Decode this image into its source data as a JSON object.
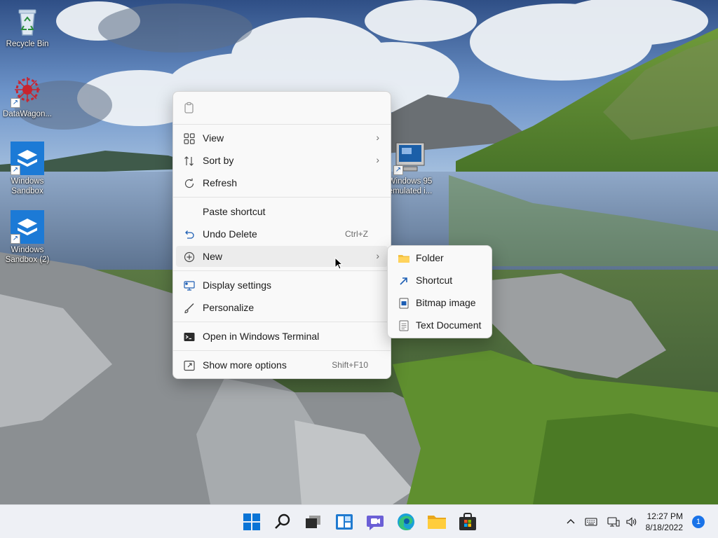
{
  "desktop": {
    "icons": [
      {
        "label": "Recycle Bin",
        "icon": "recycle-bin-icon",
        "shortcut": false
      },
      {
        "label": "DataWagon...",
        "icon": "datawagon-icon",
        "shortcut": true
      },
      {
        "label": "Windows Sandbox",
        "icon": "windows-sandbox-icon",
        "shortcut": true
      },
      {
        "label": "Windows Sandbox (2)",
        "icon": "windows-sandbox-icon",
        "shortcut": true
      },
      {
        "label": "Windows 95 emulated i...",
        "icon": "computer-monitor-icon",
        "shortcut": true
      }
    ]
  },
  "context_menu": {
    "toolbar": [
      {
        "icon": "copy-icon"
      }
    ],
    "items": [
      {
        "label": "View",
        "icon": "view-grid-icon",
        "submenu": true
      },
      {
        "label": "Sort by",
        "icon": "sort-icon",
        "submenu": true
      },
      {
        "label": "Refresh",
        "icon": "refresh-icon"
      },
      {
        "label": "Paste shortcut",
        "icon": ""
      },
      {
        "label": "Undo Delete",
        "icon": "undo-icon",
        "shortcut": "Ctrl+Z"
      },
      {
        "label": "New",
        "icon": "new-plus-icon",
        "submenu": true,
        "active": true
      },
      {
        "label": "Display settings",
        "icon": "display-settings-icon"
      },
      {
        "label": "Personalize",
        "icon": "personalize-brush-icon"
      },
      {
        "label": "Open in Windows Terminal",
        "icon": "terminal-icon"
      },
      {
        "label": "Show more options",
        "icon": "show-more-options-icon",
        "shortcut": "Shift+F10"
      }
    ]
  },
  "new_submenu": {
    "items": [
      {
        "label": "Folder",
        "icon": "folder-icon"
      },
      {
        "label": "Shortcut",
        "icon": "shortcut-arrow-icon"
      },
      {
        "label": "Bitmap image",
        "icon": "bitmap-image-icon"
      },
      {
        "label": "Text Document",
        "icon": "text-document-icon"
      }
    ]
  },
  "taskbar": {
    "apps": [
      {
        "name": "Start",
        "icon": "windows-start-icon"
      },
      {
        "name": "Search",
        "icon": "search-icon"
      },
      {
        "name": "Task View",
        "icon": "task-view-icon"
      },
      {
        "name": "Widgets",
        "icon": "widgets-icon"
      },
      {
        "name": "Chat",
        "icon": "teams-chat-icon"
      },
      {
        "name": "Microsoft Edge",
        "icon": "edge-browser-icon"
      },
      {
        "name": "File Explorer",
        "icon": "file-explorer-icon"
      },
      {
        "name": "Microsoft Store",
        "icon": "store-icon"
      }
    ],
    "tray": {
      "icons": [
        "chevron-up-icon",
        "keyboard-icon",
        "network-icon",
        "volume-icon"
      ],
      "time": "12:27 PM",
      "date": "8/18/2022",
      "notification_count": "1"
    }
  },
  "colors": {
    "accent": "#0078d4",
    "menu_bg": "#f9f9f9",
    "taskbar_bg": "#eef0f5",
    "notification_badge": "#1a73e8"
  }
}
